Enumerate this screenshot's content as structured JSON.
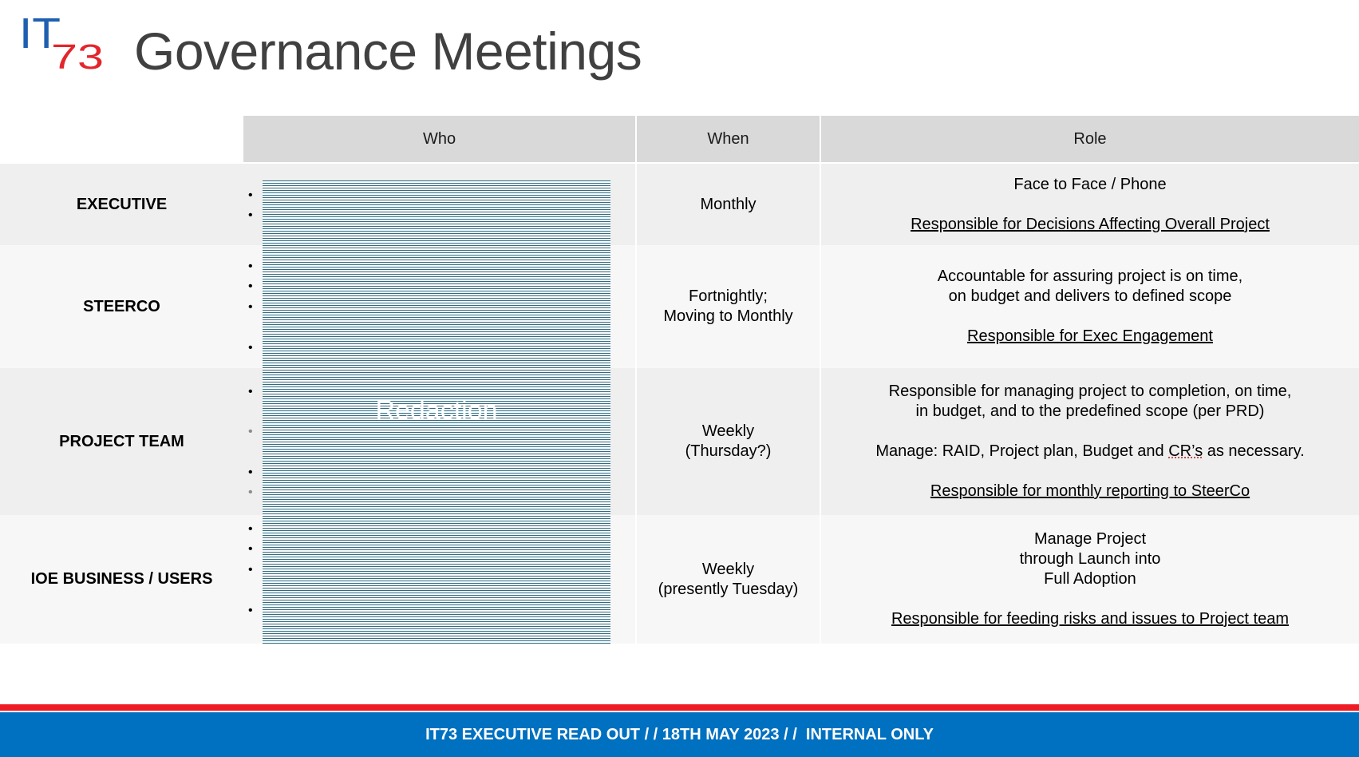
{
  "header": {
    "logo_text": "IT73",
    "title": "Governance Meetings"
  },
  "table": {
    "columns": [
      "Who",
      "When",
      "Role"
    ],
    "rows": [
      {
        "name": "EXECUTIVE",
        "when": [
          "Monthly"
        ],
        "role_lines": [
          "Face to Face / Phone"
        ],
        "role_responsibility": "Responsible for Decisions Affecting Overall Project"
      },
      {
        "name": "STEERCO",
        "when": [
          "Fortnightly;",
          "Moving to Monthly"
        ],
        "role_lines": [
          "Accountable for assuring project is on time,",
          "on budget and delivers to defined scope"
        ],
        "role_responsibility": "Responsible for Exec Engagement"
      },
      {
        "name": "PROJECT TEAM",
        "when": [
          "Weekly",
          "(Thursday?)"
        ],
        "role_lines": [
          "Responsible for managing project to completion, on time,",
          "in budget, and to the predefined scope (per PRD)"
        ],
        "role_extra_prefix": "Manage: RAID, Project plan, Budget and ",
        "role_extra_flagged": "CR’s",
        "role_extra_suffix": " as necessary.",
        "role_responsibility": "Responsible for monthly reporting to SteerCo"
      },
      {
        "name": "IOE BUSINESS / USERS",
        "when": [
          "Weekly",
          "(presently Tuesday)"
        ],
        "role_lines": [
          "Manage Project",
          "through Launch into",
          "Full Adoption"
        ],
        "role_responsibility": "Responsible for feeding risks and issues to Project team"
      }
    ],
    "redaction_label": "Redaction",
    "bullet_glyph": "•"
  },
  "footer": {
    "text": "IT73 EXECUTIVE READ OUT / / 18TH MAY 2023 / /  INTERNAL ONLY",
    "colors": {
      "bar": "#0070c0",
      "stripe": "#ee1c25"
    }
  }
}
